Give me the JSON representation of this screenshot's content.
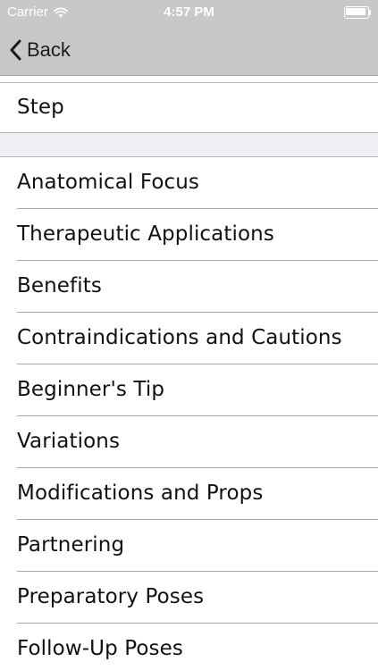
{
  "status_bar": {
    "carrier": "Carrier",
    "time": "4:57 PM",
    "icons": [
      "wifi-icon",
      "battery-icon"
    ]
  },
  "nav": {
    "back_label": "Back",
    "back_icon": "chevron-left-icon"
  },
  "step_section": {
    "label": "Step"
  },
  "menu": {
    "items": [
      {
        "label": "Anatomical Focus"
      },
      {
        "label": "Therapeutic Applications"
      },
      {
        "label": "Benefits"
      },
      {
        "label": "Contraindications and Cautions"
      },
      {
        "label": "Beginner's Tip"
      },
      {
        "label": "Variations"
      },
      {
        "label": "Modifications and Props"
      },
      {
        "label": "Partnering"
      },
      {
        "label": "Preparatory Poses"
      },
      {
        "label": "Follow-Up Poses"
      }
    ]
  },
  "colors": {
    "nav_bar": "#c8c8c9",
    "section_gap": "#efeff4",
    "separator": "#a6a6a8",
    "text": "#111111"
  }
}
